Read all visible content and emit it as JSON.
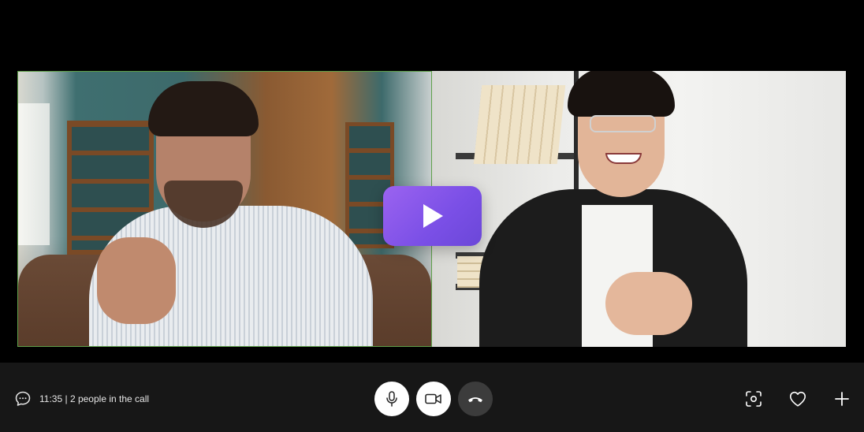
{
  "call": {
    "time": "11:35",
    "separator": "|",
    "participants_text": "2 people in the call"
  },
  "participants": [
    {
      "id": "participant-1",
      "highlighted": true,
      "highlight_color": "#5fa04a"
    },
    {
      "id": "participant-2",
      "highlighted": false
    }
  ],
  "overlay": {
    "icon": "play-icon",
    "accent_gradient": [
      "#9b63f0",
      "#6b47d8"
    ]
  },
  "controls": {
    "microphone": {
      "icon": "microphone-icon",
      "state": "on"
    },
    "camera": {
      "icon": "video-camera-icon",
      "state": "on"
    },
    "end_call": {
      "icon": "phone-hangup-icon"
    }
  },
  "tools": [
    {
      "icon": "screenshot-icon"
    },
    {
      "icon": "heart-icon"
    },
    {
      "icon": "plus-icon"
    }
  ],
  "colors": {
    "background": "#000000",
    "bar": "#171717",
    "button_light": "#ffffff",
    "button_dark": "#3c3c3c",
    "text": "#e6e6e6"
  }
}
